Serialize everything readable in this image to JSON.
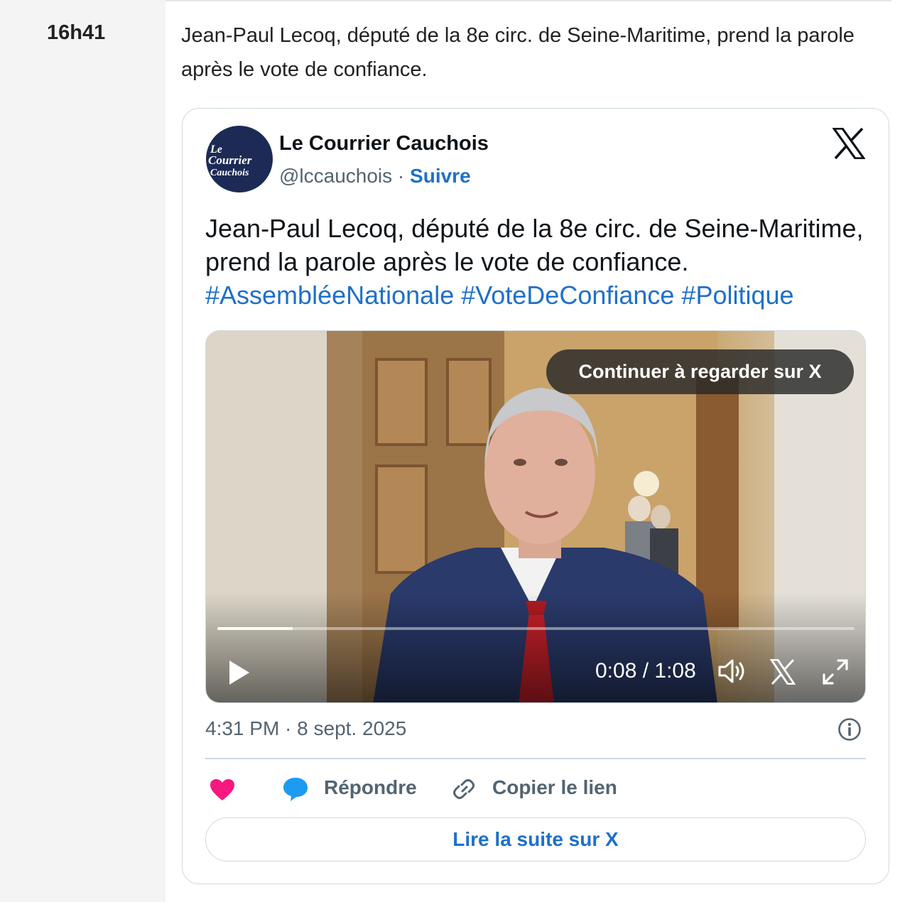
{
  "entry": {
    "time": "16h41",
    "text": "Jean-Paul Lecoq, député de la 8e circ. de Seine-Maritime, prend la parole après le vote de confiance."
  },
  "tweet": {
    "avatar_text": [
      "Le",
      "Courrier",
      "Cauchois"
    ],
    "author_name": "Le Courrier Cauchois",
    "handle": "@lccauchois",
    "separator": " · ",
    "follow_label": "Suivre",
    "body": "Jean-Paul Lecoq, député de la 8e circ. de Seine-Maritime, prend la parole après le vote de confiance.",
    "hashtags": "#AssembléeNationale #VoteDeConfiance #Politique",
    "video": {
      "continue_label": "Continuer à regarder sur X",
      "current_time": "0:08",
      "duration": "1:08",
      "time_display": "0:08 / 1:08",
      "progress_fraction": 0.118
    },
    "timestamp": "4:31 PM · 8 sept. 2025",
    "actions": {
      "reply_label": "Répondre",
      "copy_link_label": "Copier le lien"
    },
    "read_more_label": "Lire la suite sur X"
  },
  "colors": {
    "link_blue": "#1d70c9",
    "heart": "#f91880",
    "reply_icon": "#1d9bf0",
    "muted": "#536471",
    "border": "#cfd9de"
  },
  "icons": [
    "x-logo-icon",
    "play-icon",
    "volume-icon",
    "fullscreen-icon",
    "info-icon",
    "heart-icon",
    "reply-bubble-icon",
    "link-icon"
  ]
}
